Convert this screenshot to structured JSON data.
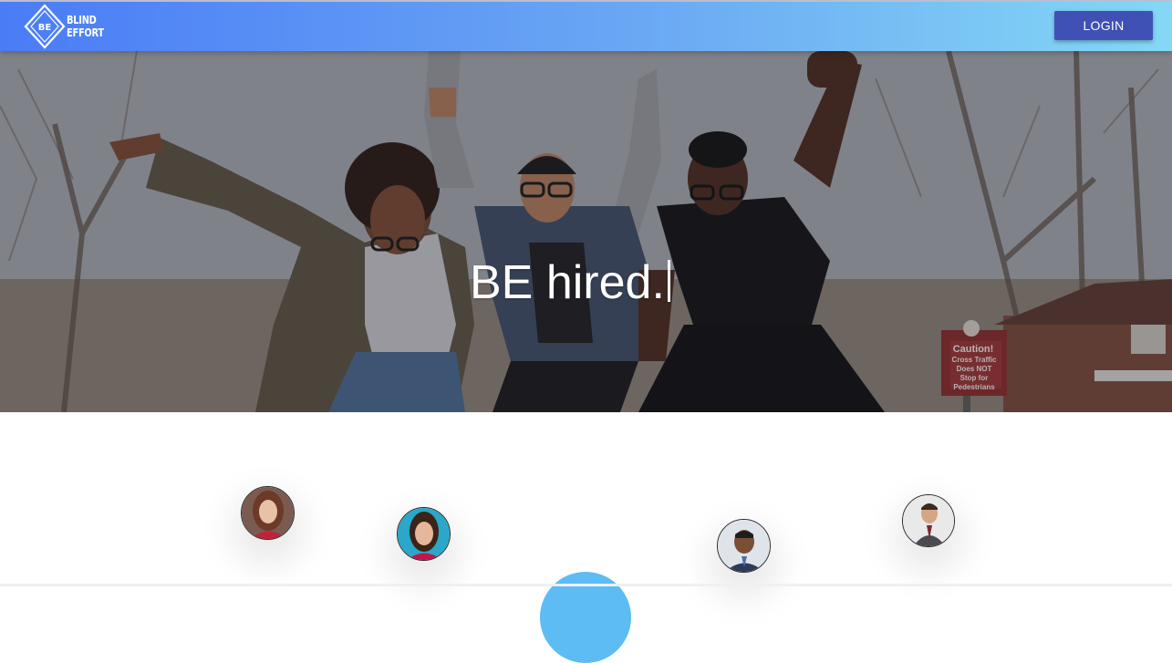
{
  "navbar": {
    "logo_mark": "BE",
    "logo_line1": "BLIND",
    "logo_line2": "EFFORT",
    "login_label": "LOGIN"
  },
  "hero": {
    "headline": "BE hired.",
    "sign_text": "Caution! Cross Traffic Does NOT Stop for Pedestrians"
  },
  "testimonials": [
    {
      "icon": "avatar-woman-red"
    },
    {
      "icon": "avatar-woman-teal"
    },
    {
      "icon": "avatar-man-suit"
    },
    {
      "icon": "avatar-man-vest"
    }
  ],
  "colors": {
    "navbar_start": "#4a7cf6",
    "navbar_end": "#84d8f5",
    "login_button": "#3f51b5",
    "accent_circle": "#5cbcf3"
  }
}
